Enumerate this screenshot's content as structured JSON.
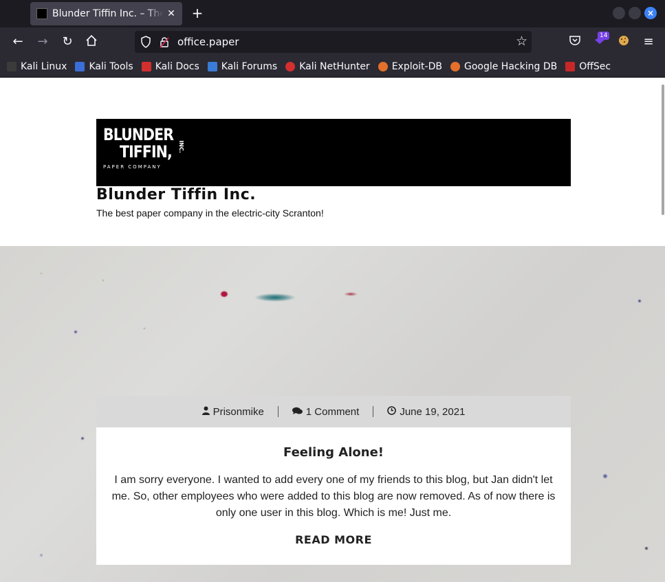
{
  "browser": {
    "tab_title": "Blunder Tiffin Inc. – The best paper company in the electric-city Scranton!",
    "tab_close": "✕",
    "new_tab": "+",
    "url": "office.paper",
    "extension_badge": "14",
    "bookmarks": [
      {
        "label": "Kali Linux",
        "color": "#3b3b3b"
      },
      {
        "label": "Kali Tools",
        "color": "#3b6fd8"
      },
      {
        "label": "Kali Docs",
        "color": "#d32f2f"
      },
      {
        "label": "Kali Forums",
        "color": "#3a7bd5"
      },
      {
        "label": "Kali NetHunter",
        "color": "#d32f2f"
      },
      {
        "label": "Exploit-DB",
        "color": "#e3702b"
      },
      {
        "label": "Google Hacking DB",
        "color": "#e3702b"
      },
      {
        "label": "OffSec",
        "color": "#c62828"
      }
    ]
  },
  "site": {
    "logo": {
      "line1": "BLUNDER",
      "line2": "TIFFIN,",
      "inc": "INC.",
      "line3": "PAPER COMPANY"
    },
    "title": "Blunder Tiffin Inc.",
    "tagline": "The best paper company in the electric-city Scranton!"
  },
  "post": {
    "author": "Prisonmike",
    "comments": "1 Comment",
    "date": "June 19, 2021",
    "title": "Feeling Alone!",
    "excerpt": "I am sorry everyone. I wanted to add every one of my friends to this blog, but Jan didn't let me. So, other employees who were added to this blog are now removed. As of now there is only one user in this blog. Which is me! Just me.",
    "read_more": "READ MORE"
  }
}
